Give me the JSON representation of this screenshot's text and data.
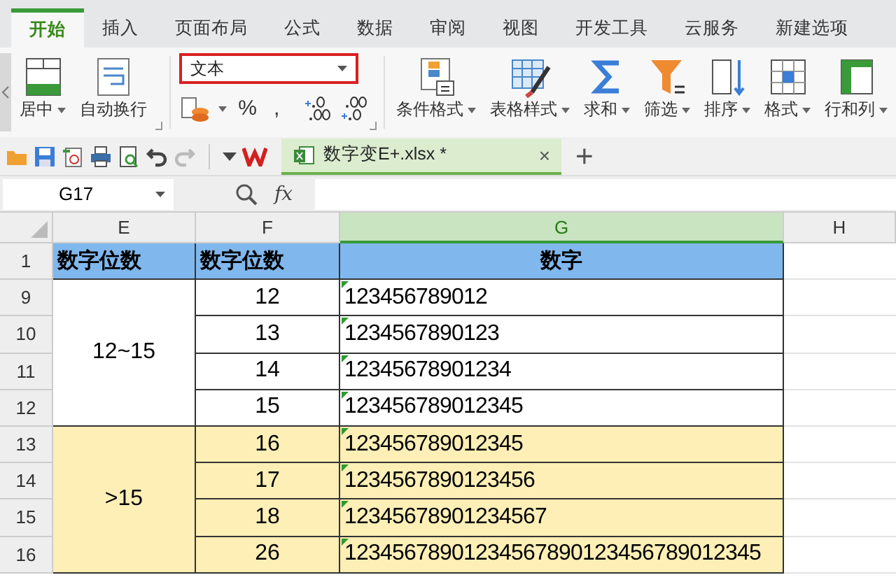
{
  "tabs": [
    {
      "label": "开始",
      "selected": true
    },
    {
      "label": "插入",
      "selected": false
    },
    {
      "label": "页面布局",
      "selected": false
    },
    {
      "label": "公式",
      "selected": false
    },
    {
      "label": "数据",
      "selected": false
    },
    {
      "label": "审阅",
      "selected": false
    },
    {
      "label": "视图",
      "selected": false
    },
    {
      "label": "开发工具",
      "selected": false
    },
    {
      "label": "云服务",
      "selected": false
    },
    {
      "label": "新建选项",
      "selected": false
    }
  ],
  "ribbon": {
    "left_buttons": [
      {
        "kind": "merge",
        "label": "居中",
        "dropdown": true
      },
      {
        "kind": "wrap",
        "label": "自动换行",
        "dropdown": false
      }
    ],
    "number_format": {
      "value": "文本",
      "highlighted": true
    },
    "number_buttons": [
      {
        "kind": "currency"
      },
      {
        "kind": "text",
        "label": "%"
      },
      {
        "kind": "text",
        "label": ","
      },
      {
        "kind": "decimal-up"
      },
      {
        "kind": "decimal-down"
      }
    ],
    "right_buttons": [
      {
        "kind": "cond",
        "label": "条件格式",
        "dropdown": true
      },
      {
        "kind": "style",
        "label": "表格样式",
        "dropdown": true
      },
      {
        "kind": "sum",
        "label": "求和",
        "dropdown": true
      },
      {
        "kind": "filter",
        "label": "筛选",
        "dropdown": true
      },
      {
        "kind": "sort",
        "label": "排序",
        "dropdown": true
      },
      {
        "kind": "format",
        "label": "格式",
        "dropdown": true
      },
      {
        "kind": "rowcol",
        "label": "行和列",
        "dropdown": true
      }
    ]
  },
  "document_tab": {
    "title": "数字变E+.xlsx *",
    "close": "×",
    "add": "+"
  },
  "formula_bar": {
    "name_box": "G17",
    "fx": "fx"
  },
  "columns": [
    {
      "label": "E",
      "selected": false
    },
    {
      "label": "F",
      "selected": false
    },
    {
      "label": "G",
      "selected": true
    },
    {
      "label": "H",
      "selected": false
    }
  ],
  "header_row": {
    "row": "1",
    "cells": [
      "数字位数",
      "数字位数",
      "数字"
    ]
  },
  "groups": [
    {
      "label": "12~15",
      "highlighted": false,
      "rows": [
        {
          "row": "9",
          "f": "12",
          "g": "123456789012",
          "marker": true
        },
        {
          "row": "10",
          "f": "13",
          "g": "1234567890123",
          "marker": true
        },
        {
          "row": "11",
          "f": "14",
          "g": "12345678901234",
          "marker": true
        },
        {
          "row": "12",
          "f": "15",
          "g": "123456789012345",
          "marker": true
        }
      ]
    },
    {
      "label": ">15",
      "highlighted": true,
      "rows": [
        {
          "row": "13",
          "f": "16",
          "g": "123456789012345",
          "marker": true
        },
        {
          "row": "14",
          "f": "17",
          "g": "1234567890123456",
          "marker": true
        },
        {
          "row": "15",
          "f": "18",
          "g": "12345678901234567",
          "marker": true
        },
        {
          "row": "16",
          "f": "26",
          "g": "12345678901234567890123456789012345",
          "marker": true
        }
      ]
    }
  ]
}
